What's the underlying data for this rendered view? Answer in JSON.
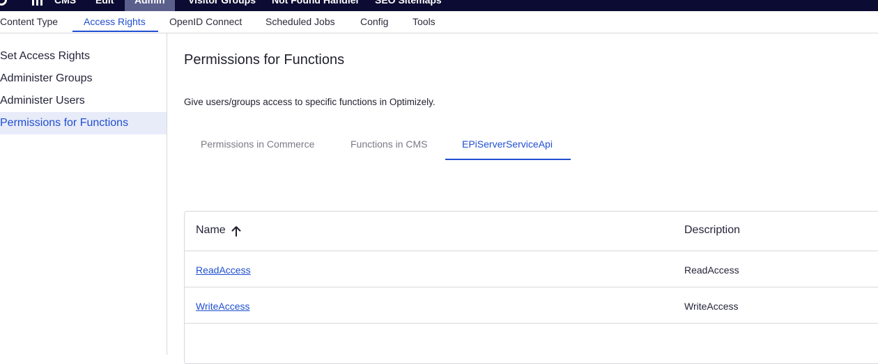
{
  "topnav": {
    "items": [
      {
        "label": "CMS"
      },
      {
        "label": "Edit"
      },
      {
        "label": "Admin"
      },
      {
        "label": "Visitor Groups"
      },
      {
        "label": "Not Found Handler"
      },
      {
        "label": "SEO Sitemaps"
      }
    ]
  },
  "subnav": {
    "items": [
      {
        "label": "Content Type"
      },
      {
        "label": "Access Rights"
      },
      {
        "label": "OpenID Connect"
      },
      {
        "label": "Scheduled Jobs"
      },
      {
        "label": "Config"
      },
      {
        "label": "Tools"
      }
    ]
  },
  "sidebar": {
    "items": [
      {
        "label": "Set Access Rights"
      },
      {
        "label": "Administer Groups"
      },
      {
        "label": "Administer Users"
      },
      {
        "label": "Permissions for Functions"
      }
    ]
  },
  "main": {
    "title": "Permissions for Functions",
    "description": "Give users/groups access to specific functions in Optimizely.",
    "tabs": [
      {
        "label": "Permissions in Commerce"
      },
      {
        "label": "Functions in CMS"
      },
      {
        "label": "EPiServerServiceApi"
      }
    ],
    "table": {
      "columns": [
        "Name",
        "Description"
      ],
      "rows": [
        {
          "name": "ReadAccess",
          "description": "ReadAccess"
        },
        {
          "name": "WriteAccess",
          "description": "WriteAccess"
        }
      ]
    }
  },
  "colors": {
    "accent": "#1f4fd1",
    "topbar": "#0b0b33",
    "active_side_bg": "#e8ebf8"
  }
}
